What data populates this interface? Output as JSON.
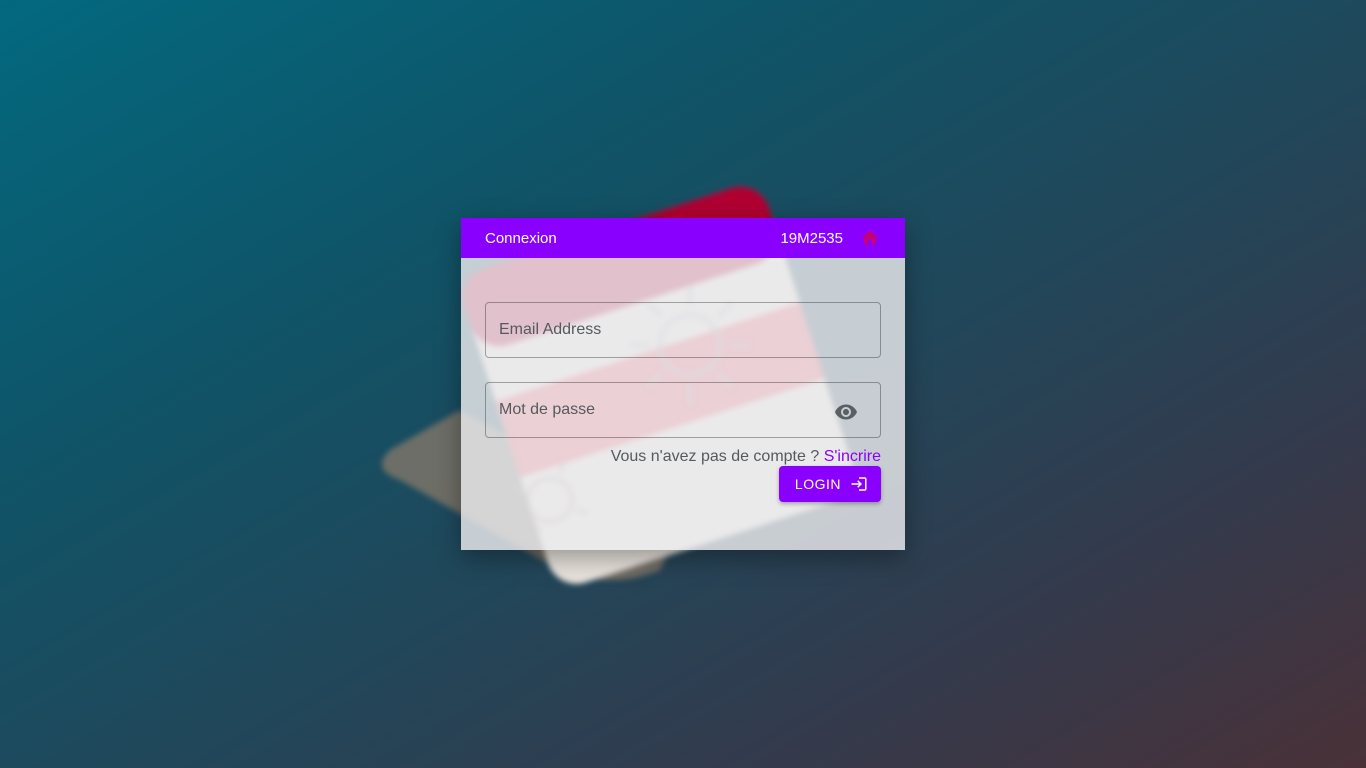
{
  "header": {
    "title": "Connexion",
    "code": "19M2535",
    "home_icon": "home-icon"
  },
  "form": {
    "email_placeholder": "Email Address",
    "email_value": "",
    "password_placeholder": "Mot de passe",
    "password_value": "",
    "eye_icon": "eye-icon"
  },
  "signup": {
    "prompt": "Vous n'avez pas de compte ?",
    "link": "S'incrire"
  },
  "login_button": {
    "label": "LOGIN",
    "icon": "login-icon"
  },
  "colors": {
    "accent": "#8a00ff",
    "home_icon": "#c4007a"
  }
}
